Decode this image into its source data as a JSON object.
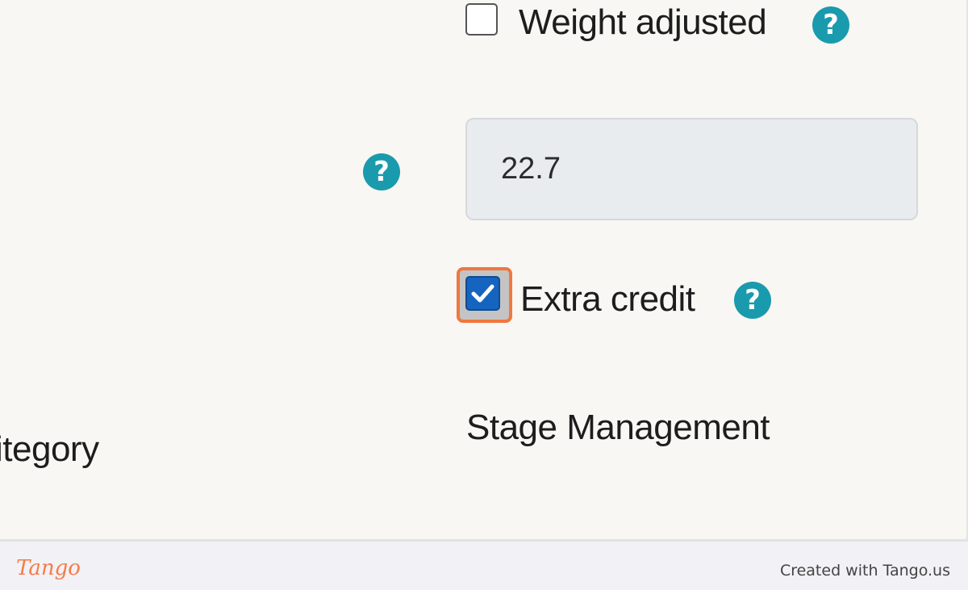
{
  "form": {
    "weight_adjusted": {
      "label": "Weight adjusted",
      "checked": false,
      "help_icon": "question-circle-icon"
    },
    "weight_value": {
      "help_icon": "question-circle-icon",
      "value": "22.7"
    },
    "extra_credit": {
      "label": "Extra credit",
      "checked": true,
      "help_icon": "question-circle-icon"
    },
    "category": {
      "label_fragment": "itegory",
      "value": "Stage Management"
    }
  },
  "footer": {
    "logo": "Tango",
    "credit": "Created with Tango.us"
  },
  "colors": {
    "accent": "#1a9aad",
    "highlight": "#f0773f",
    "checkbox_checked": "#1565c0",
    "background": "#f8f7f3"
  }
}
